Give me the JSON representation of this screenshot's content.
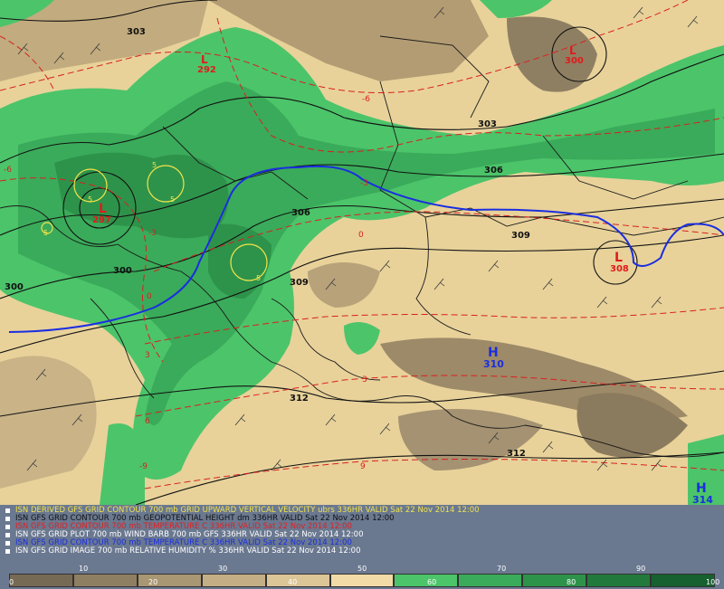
{
  "legend": {
    "lines": [
      {
        "text": "ISN DERIVED GFS GRID CONTOUR 700 mb GRID UPWARD VERTICAL VELOCITY ubrs 336HR VALID Sat 22 Nov 2014 12:00",
        "color": "#f2e34b"
      },
      {
        "text": "ISN GFS GRID CONTOUR 700 mb GEOPOTENTIAL HEIGHT dm 336HR VALID Sat 22 Nov 2014 12:00",
        "color": "#111111"
      },
      {
        "text": "ISN GFS GRID CONTOUR 700 mb TEMPERATURE C 336HR VALID Sat 22 Nov 2014 12:00",
        "color": "#e02020"
      },
      {
        "text": "ISN GFS GRID PLOT 700 mb WIND BARB 700 mb GFS 336HR VALID Sat 22 Nov 2014 12:00",
        "color": "#ffffff"
      },
      {
        "text": "ISN GFS GRID CONTOUR 700 mb TEMPERATURE C 336HR VALID Sat 22 Nov 2014 12:00",
        "color": "#1a2ee0"
      },
      {
        "text": "ISN GFS GRID IMAGE 700 mb RELATIVE HUMIDITY % 336HR VALID Sat 22 Nov 2014 12:00",
        "color": "#ffffff"
      }
    ]
  },
  "colorbar": {
    "ticks": [
      "0",
      "10",
      "20",
      "30",
      "40",
      "50",
      "60",
      "70",
      "80",
      "90",
      "100"
    ],
    "colors": [
      "#776a55",
      "#8f7f62",
      "#a99673",
      "#c4ae85",
      "#dcc596",
      "#f2dba6",
      "#4cc46a",
      "#3aab5a",
      "#2e934a",
      "#217a3b",
      "#176130"
    ]
  },
  "map": {
    "height_labels": [
      "303",
      "303",
      "306",
      "306",
      "309",
      "309",
      "312",
      "312",
      "300",
      "300"
    ],
    "temp_labels": [
      "-6",
      "-6",
      "-3",
      "-3",
      "0",
      "0",
      "3",
      "3",
      "6",
      "9",
      "-9"
    ],
    "centers": [
      {
        "type": "L",
        "value": "292",
        "color": "#e01b1b"
      },
      {
        "type": "L",
        "value": "297",
        "color": "#e01b1b"
      },
      {
        "type": "L",
        "value": "300",
        "color": "#e01b1b"
      },
      {
        "type": "L",
        "value": "308",
        "color": "#e01b1b"
      },
      {
        "type": "H",
        "value": "310",
        "color": "#1a2ee0"
      },
      {
        "type": "H",
        "value": "314",
        "color": "#1a2ee0"
      }
    ],
    "vv_labels": [
      "5",
      "5",
      "5",
      "5",
      "5"
    ]
  }
}
